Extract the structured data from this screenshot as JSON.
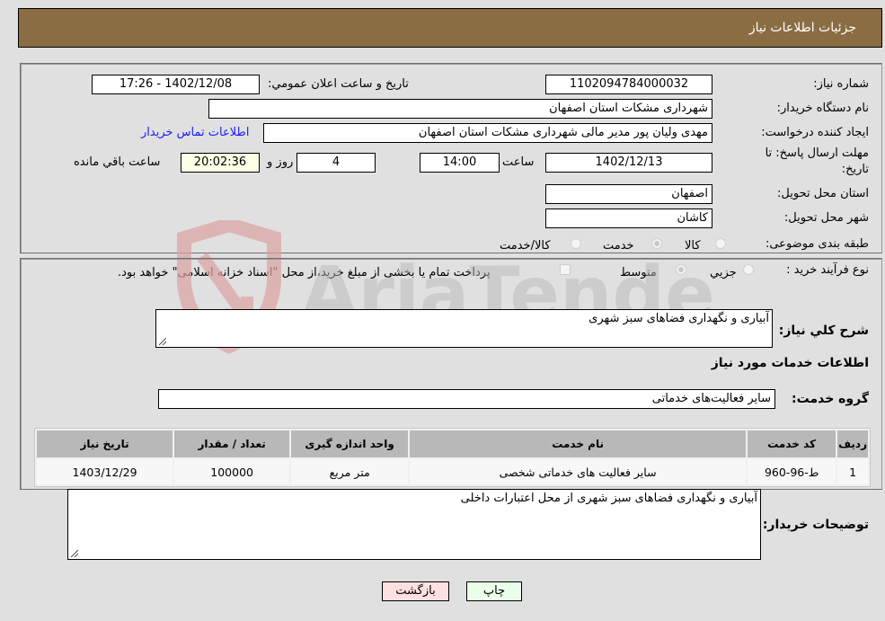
{
  "header": {
    "title": "جزئیات اطلاعات نیاز"
  },
  "details": {
    "need_number": {
      "label": "شماره نیاز:",
      "value": "1102094784000032"
    },
    "announce": {
      "label": "تاریخ و ساعت اعلان عمومي:",
      "value": "1402/12/08 - 17:26"
    },
    "buyer_org": {
      "label": "نام دستگاه خریدار:",
      "value": "شهرداری مشکات استان اصفهان"
    },
    "creator": {
      "label": "ایجاد کننده درخواست:",
      "value": "مهدی ولیان پور مدیر مالی شهرداری مشکات استان اصفهان",
      "contact_link": "اطلاعات تماس خریدار"
    },
    "deadline": {
      "label_line1": "مهلت ارسال پاسخ: تا",
      "label_line2": "تاریخ:",
      "date": "1402/12/13",
      "time_label": "ساعت",
      "time": "14:00",
      "days": "4",
      "days_label": "روز و",
      "remaining": "20:02:36",
      "remaining_label": "ساعت باقي مانده"
    },
    "province": {
      "label": "استان محل تحویل:",
      "value": "اصفهان"
    },
    "city": {
      "label": "شهر محل تحویل:",
      "value": "کاشان"
    },
    "category": {
      "label": "طبقه بندی موضوعی:",
      "options": [
        {
          "label": "کالا",
          "checked": false
        },
        {
          "label": "خدمت",
          "checked": true
        },
        {
          "label": "کالا/خدمت",
          "checked": false
        }
      ]
    },
    "process": {
      "label": "نوع فرآیند خرید :",
      "options": [
        {
          "label": "جزیي",
          "checked": false
        },
        {
          "label": "متوسط",
          "checked": true
        }
      ],
      "treasury_note": "پرداخت تمام یا بخشی از مبلغ خرید،از محل \"اسناد خزانه اسلامی\" خواهد بود.",
      "treasury_checked": false
    }
  },
  "summary": {
    "label": "شرح کلي نیاز:",
    "value": "آبیاری و نگهداری فضاهای سبز شهری"
  },
  "services": {
    "section_title": "اطلاعات خدمات مورد نیاز",
    "group_label": "گروه خدمت:",
    "group_value": "سایر فعالیت‌های خدماتی",
    "table": {
      "headers": [
        "ردیف",
        "کد خدمت",
        "نام خدمت",
        "واحد اندازه گیری",
        "تعداد / مقدار",
        "تاریخ نیاز"
      ],
      "rows": [
        [
          "1",
          "ط-96-960",
          "سایر فعالیت های خدماتی شخصی",
          "متر مربع",
          "100000",
          "1403/12/29"
        ]
      ]
    }
  },
  "buyer_notes": {
    "label": "توضیحات خریدار:",
    "value": "آبیاری و نگهداری فضاهای سبز شهری از محل اعتبارات داخلی"
  },
  "buttons": {
    "print": "چاپ",
    "back": "بازگشت"
  },
  "watermark": {
    "text": "AriaTender.neT"
  }
}
